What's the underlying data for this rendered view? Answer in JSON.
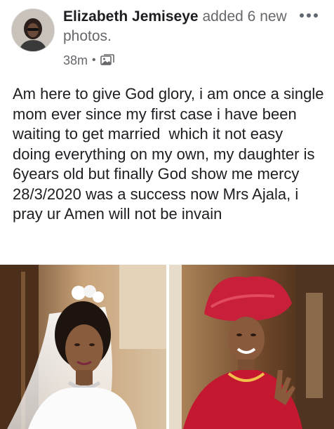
{
  "post": {
    "author": "Elizabeth Jemiseye",
    "action": " added 6 new photos.",
    "time": "38m",
    "separator": "•",
    "body": "Am here to give God glory, i am once a single mom ever since my first case i have been waiting to get married  which it not easy doing everything on my own, my daughter is 6years old but finally God show me mercy 28/3/2020 was a success now Mrs Ajala, i pray ur Amen will not be invain"
  },
  "icons": {
    "audience": "photos-icon",
    "menu": "more-options-icon"
  },
  "photos": [
    {
      "name": "bride-white-veil-photo"
    },
    {
      "name": "bride-red-gele-photo"
    }
  ],
  "colors": {
    "text": "#1c1e21",
    "secondary": "#65676b",
    "background": "#ffffff"
  }
}
